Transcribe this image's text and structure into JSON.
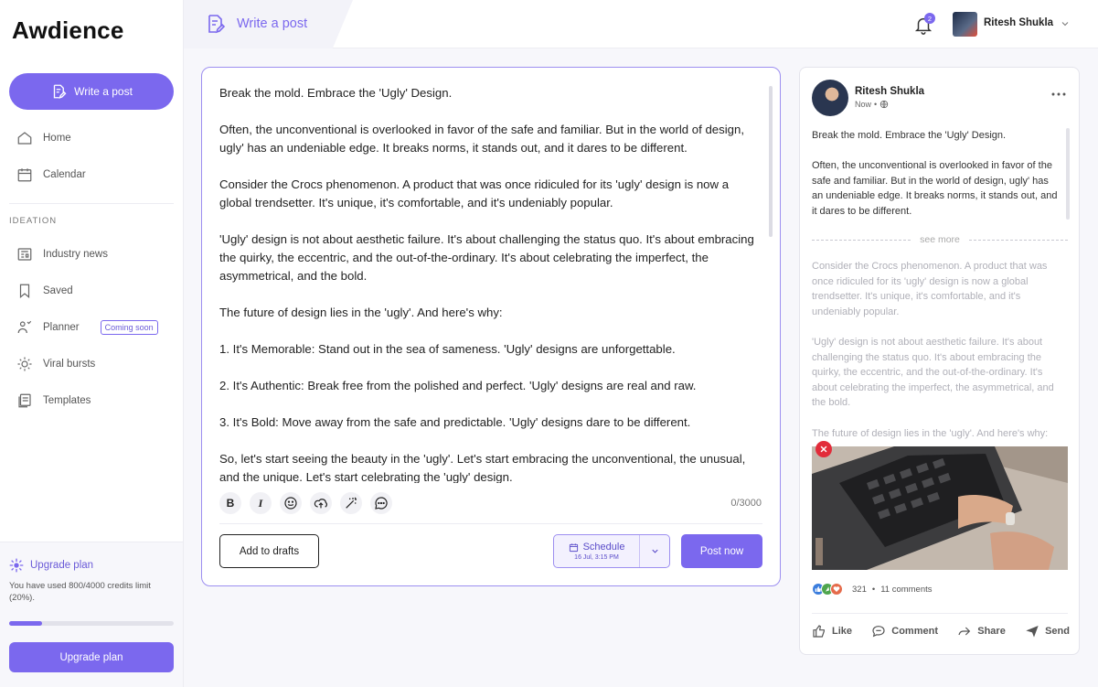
{
  "brand": {
    "name": "Awdience"
  },
  "sidebar": {
    "write_label": "Write a post",
    "nav": [
      {
        "label": "Home",
        "icon": "home-icon"
      },
      {
        "label": "Calendar",
        "icon": "calendar-icon"
      }
    ],
    "section_label": "IDEATION",
    "ideation": [
      {
        "label": "Industry news",
        "icon": "news-icon"
      },
      {
        "label": "Saved",
        "icon": "bookmark-icon"
      },
      {
        "label": "Planner",
        "icon": "planner-icon",
        "badge": "Coming soon"
      },
      {
        "label": "Viral bursts",
        "icon": "burst-icon"
      },
      {
        "label": "Templates",
        "icon": "templates-icon"
      }
    ],
    "upgrade": {
      "title": "Upgrade plan",
      "credits_text": "You have used 800/4000 credits limit (20%).",
      "progress": 0.2,
      "button_label": "Upgrade plan"
    }
  },
  "topbar": {
    "tab_label": "Write a post",
    "notification_count": "2",
    "user_name": "Ritesh Shukla"
  },
  "editor": {
    "paragraphs": [
      "Break the mold. Embrace the 'Ugly' Design.",
      "Often, the unconventional is overlooked in favor of the safe and familiar. But in the world of design, ugly' has an undeniable edge. It breaks norms, it stands out, and it dares to be different.",
      "Consider the Crocs phenomenon. A product that was once ridiculed for its 'ugly' design is now a global trendsetter. It's unique, it's comfortable, and it's undeniably popular.",
      "'Ugly' design is not about aesthetic failure. It's about challenging the status quo. It's about embracing the quirky, the eccentric, and the out-of-the-ordinary. It's about celebrating the imperfect, the asymmetrical, and the bold.",
      "The future of design lies in the 'ugly'. And here's why:",
      "1. It's Memorable: Stand out in the sea of sameness. 'Ugly' designs are unforgettable.",
      "2. It's Authentic: Break free from the polished and perfect. 'Ugly' designs are real and raw.",
      "3. It's Bold: Move away from the safe and predictable. 'Ugly' designs dare to be different.",
      "So, let's start seeing the beauty in the 'ugly'. Let's start embracing the unconventional, the unusual, and the unique. Let's start celebrating the 'ugly' design."
    ],
    "char_count": "0/3000",
    "drafts_label": "Add to drafts",
    "schedule_label": "Schedule",
    "schedule_date": "16 Jul, 3:15 PM",
    "post_label": "Post now"
  },
  "preview": {
    "name": "Ritesh Shukla",
    "time": "Now",
    "visible_paragraphs": [
      "Break the mold. Embrace the 'Ugly' Design.",
      "Often, the unconventional is overlooked in favor of the safe and familiar. But in the world of design, ugly' has an undeniable edge. It breaks norms, it stands out, and it dares to be different."
    ],
    "see_more": "see more",
    "faded_paragraphs": [
      "Consider the Crocs phenomenon. A product that was once ridiculed for its 'ugly' design is now a global trendsetter. It's unique, it's comfortable, and it's undeniably popular.",
      "'Ugly' design is not about aesthetic failure. It's about challenging the status quo. It's about embracing the quirky, the eccentric, and the out-of-the-ordinary. It's about celebrating the imperfect, the asymmetrical, and the bold.",
      "The future of design lies in the 'ugly'. And here's why:"
    ],
    "reaction_count": "321",
    "comments": "11 comments",
    "actions": [
      "Like",
      "Comment",
      "Share",
      "Send"
    ]
  },
  "colors": {
    "accent": "#7b68ee",
    "danger": "#e22c3a"
  }
}
